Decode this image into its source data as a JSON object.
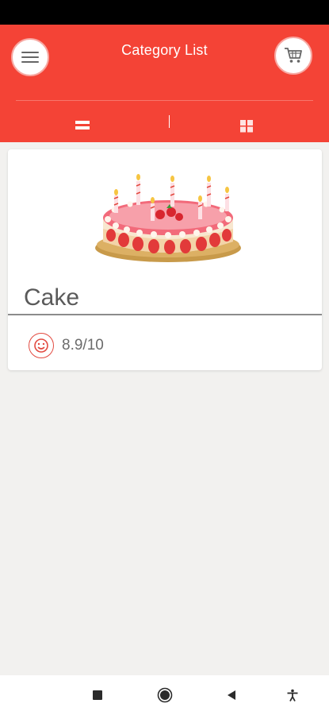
{
  "header": {
    "title": "Category List",
    "menu_icon": "hamburger-menu-icon",
    "cart_icon": "shopping-cart-icon",
    "list_view_icon": "list-view-icon",
    "grid_view_icon": "grid-view-icon",
    "accent_color": "#f44336"
  },
  "categories": [
    {
      "name": "Cake",
      "rating": "8.9/10",
      "rating_icon": "smiley-icon",
      "image": "birthday-cake"
    }
  ],
  "navbar": {
    "icons": [
      "recent-apps-icon",
      "home-icon",
      "back-icon",
      "accessibility-icon"
    ]
  }
}
